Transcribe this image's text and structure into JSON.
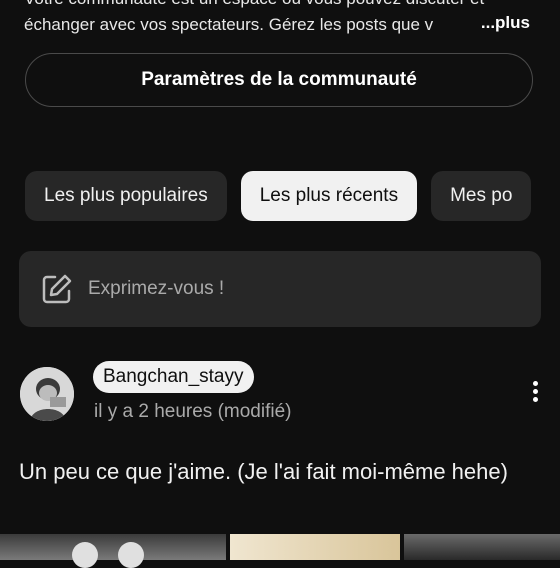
{
  "description": {
    "line1": "Votre communauté est un espace où vous pouvez discuter et",
    "line2": "échanger avec vos spectateurs. Gérez les posts que v",
    "more_label": "...plus"
  },
  "settings_button_label": "Paramètres de la communauté",
  "filter_chips": [
    {
      "label": "Les plus populaires",
      "active": false
    },
    {
      "label": "Les plus récents",
      "active": true
    },
    {
      "label": "Mes po",
      "active": false
    }
  ],
  "compose": {
    "icon": "edit-icon",
    "placeholder": "Exprimez-vous !"
  },
  "post": {
    "author": "Bangchan_stayy",
    "timestamp": "il y a 2 heures (modifié)",
    "text": "Un peu ce que j'aime. (Je l'ai fait moi-même hehe)",
    "menu_icon": "more-vert-icon"
  },
  "colors": {
    "background": "#0f0f0f",
    "chip_background": "#272727",
    "chip_active_background": "#f1f1f1",
    "text_primary": "#f1f1f1",
    "text_secondary": "#aaaaaa"
  }
}
